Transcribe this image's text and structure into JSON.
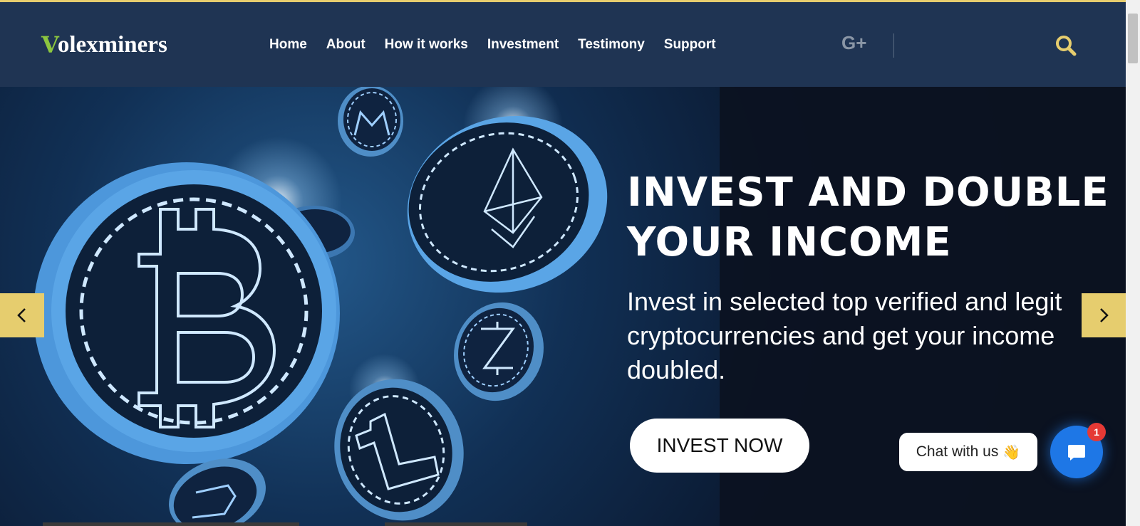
{
  "brand": {
    "logo_mark": "V",
    "logo_rest": "olexminers"
  },
  "nav": {
    "items": [
      {
        "label": "Home"
      },
      {
        "label": "About"
      },
      {
        "label": "How it works"
      },
      {
        "label": "Investment"
      },
      {
        "label": "Testimony"
      },
      {
        "label": "Support"
      }
    ]
  },
  "social": {
    "google_plus_label": "G+"
  },
  "icons": {
    "search": "search-icon",
    "prev": "chevron-left-icon",
    "next": "chevron-right-icon",
    "chat": "chat-bubble-icon",
    "wave": "waving-hand-icon"
  },
  "hero": {
    "headline_line1": "INVEST AND DOUBLE",
    "headline_line2": "YOUR INCOME",
    "subtext": "Invest in selected top verified and legit cryptocurrencies and get your income doubled.",
    "cta_label": "INVEST NOW"
  },
  "chat": {
    "prompt_label": "Chat with us",
    "wave_glyph": "👋",
    "unread_count": "1"
  },
  "colors": {
    "accent": "#e6cd6e",
    "header_bg": "#1f3453",
    "logo_green": "#8cc63f",
    "chat_blue": "#1e77e6",
    "badge_red": "#e53935"
  }
}
